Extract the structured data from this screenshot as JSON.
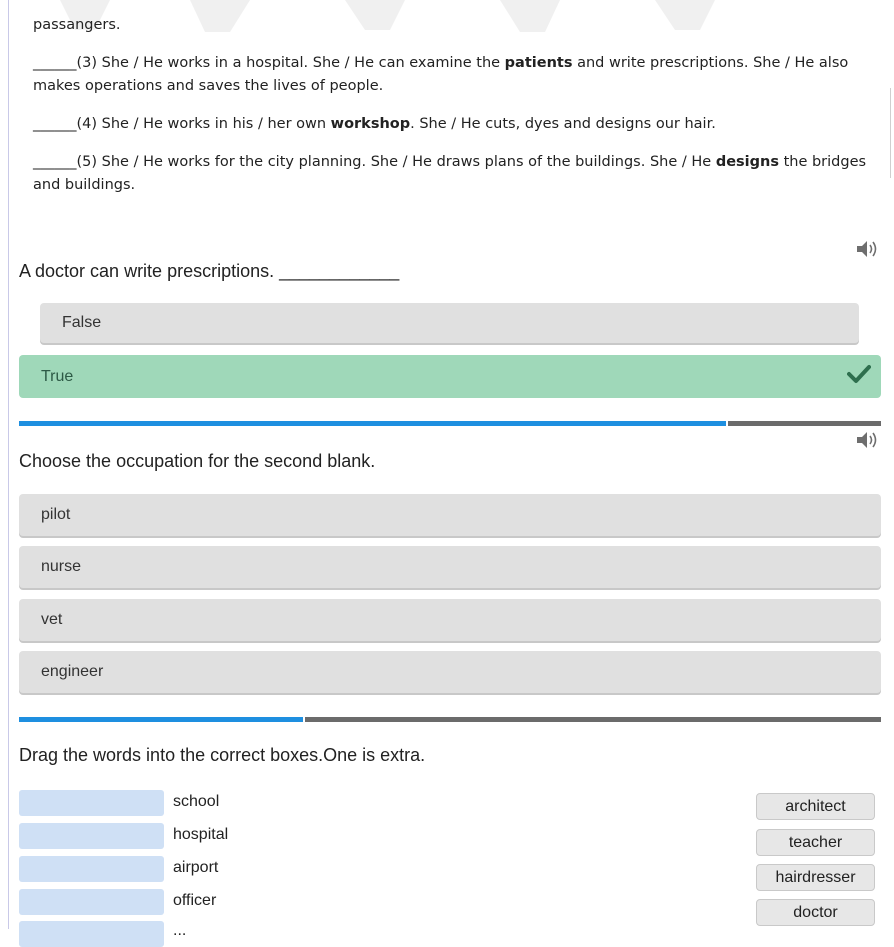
{
  "passage": {
    "line0": "passangers.",
    "item3": {
      "pre": "______(3) She / He works in a hospital. She / He can examine the ",
      "bold": "patients",
      "post": " and write prescriptions. She / He also makes operations and saves the lives of people."
    },
    "item4": {
      "pre": "______(4) She / He works in his / her own ",
      "bold": "workshop",
      "post": ". She / He cuts, dyes and designs our hair."
    },
    "item5": {
      "pre": "______(5) She / He works for the city planning. She / He draws plans of the buildings. She / He ",
      "bold": "designs",
      "post": " the bridges and buildings."
    }
  },
  "q1": {
    "text": "A doctor can write prescriptions. ____________",
    "options": [
      "False",
      "True"
    ],
    "selected": "True",
    "progress": 0.82
  },
  "q2": {
    "text": "Choose the occupation for the second blank.",
    "options": [
      "pilot",
      "nurse",
      "vet",
      "engineer"
    ],
    "progress": 0.33
  },
  "q3": {
    "text": "Drag the words into the correct boxes.One is extra.",
    "targets": [
      "school",
      "hospital",
      "airport",
      "officer",
      "..."
    ],
    "words": [
      "architect",
      "teacher",
      "hairdresser",
      "doctor"
    ]
  },
  "icons": {
    "speaker": "speaker-icon",
    "check": "checkmark-icon"
  },
  "colors": {
    "correct_bg": "#9fd8b9",
    "check": "#2e6f4e",
    "progress_fill": "#1e8fe0",
    "progress_rest": "#6b6b6b",
    "drop_box": "#cfe0f5"
  }
}
